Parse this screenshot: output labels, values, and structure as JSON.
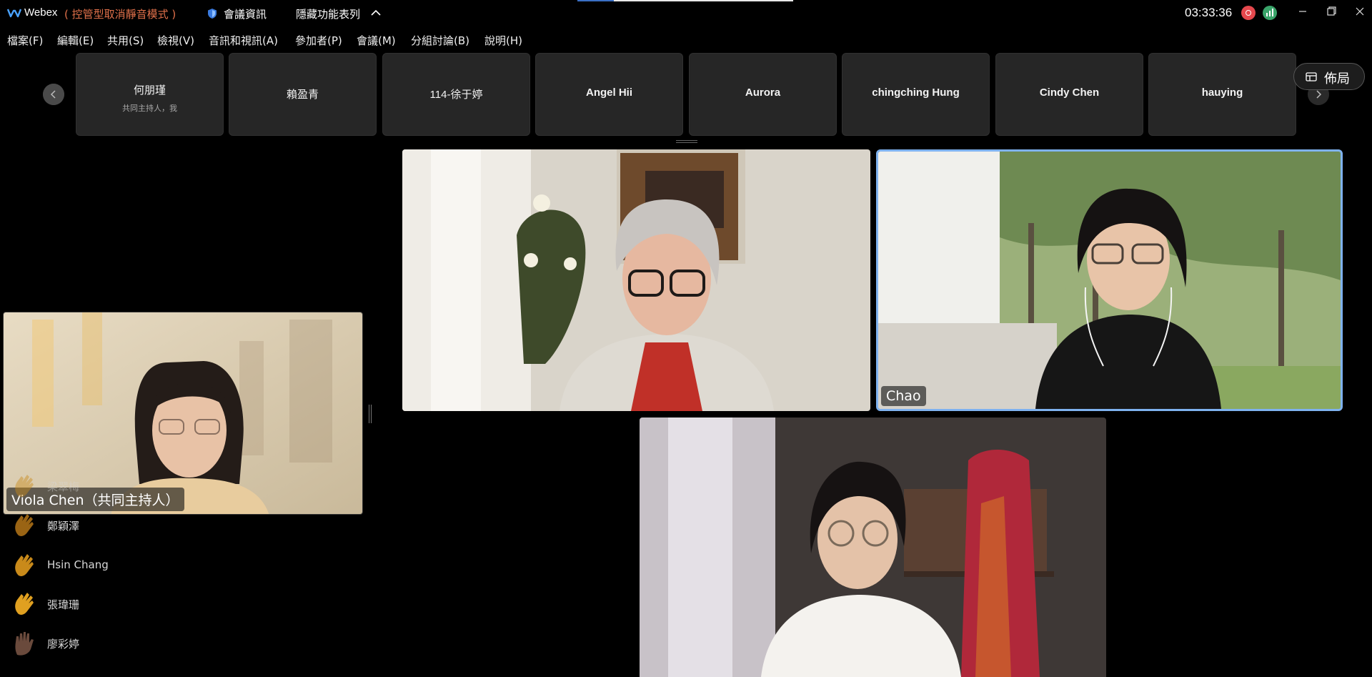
{
  "titlebar": {
    "app_name": "Webex",
    "mode": "( 控管型取消靜音模式 )",
    "meeting_info": "會議資訊",
    "hide_features": "隱藏功能表列",
    "clock": "03:33:36"
  },
  "menu": [
    {
      "label": "檔案(F)"
    },
    {
      "label": "編輯(E)"
    },
    {
      "label": "共用(S)"
    },
    {
      "label": "檢視(V)"
    },
    {
      "label": "音訊和視訊(A)"
    },
    {
      "label": "參加者(P)"
    },
    {
      "label": "會議(M)"
    },
    {
      "label": "分組討論(B)"
    },
    {
      "label": "說明(H)"
    }
  ],
  "filmstrip": {
    "tiles": [
      {
        "name": "何朋瑾",
        "sub": "共同主持人，我"
      },
      {
        "name": "賴盈青"
      },
      {
        "name": "114-徐于婷"
      },
      {
        "name": "Angel Hii"
      },
      {
        "name": "Aurora"
      },
      {
        "name": "chingching Hung"
      },
      {
        "name": "Cindy Chen"
      },
      {
        "name": "hauying"
      }
    ],
    "layout_label": "佈局"
  },
  "videos": {
    "left_label": "Viola Chen（共同主持人）",
    "top_right_label": "Chao"
  },
  "reactions": [
    {
      "name": "梁翠梅",
      "tone": "#c98a1a"
    },
    {
      "name": "鄭穎澤",
      "tone": "#9a6414"
    },
    {
      "name": "Hsin Chang",
      "tone": "#c98a1a"
    },
    {
      "name": "張瑋珊",
      "tone": "#e0a020"
    },
    {
      "name": "廖彩婷",
      "tone": "#6a4a3c"
    }
  ],
  "colors": {
    "accent": "#3a6fc4",
    "warning_text": "#e0704a",
    "active_speaker_border": "#7fb2ef",
    "record": "#e5484d",
    "stats": "#3aa46a"
  }
}
